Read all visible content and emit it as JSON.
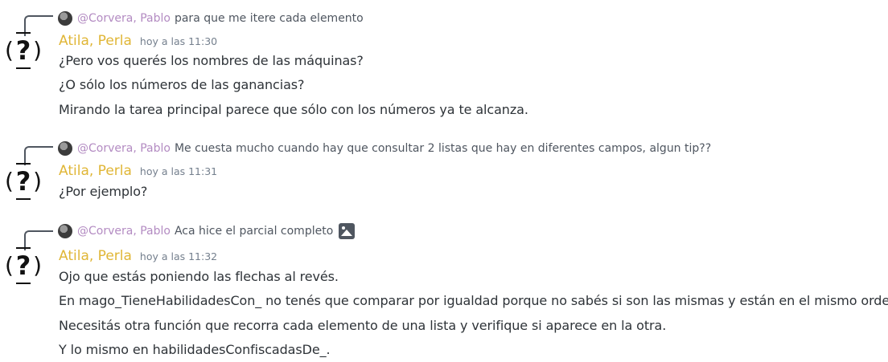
{
  "messages": [
    {
      "reply": {
        "author": "@Corvera, Pablo",
        "text": "para que me itere cada elemento",
        "has_image": false
      },
      "author": "Atila, Perla",
      "time": "hoy a las 11:30",
      "lines": [
        "¿Pero vos querés los nombres de las máquinas?",
        "¿O sólo los números de las ganancias?",
        "Mirando la tarea principal parece que sólo con los números ya te alcanza."
      ]
    },
    {
      "reply": {
        "author": "@Corvera, Pablo",
        "text": "Me cuesta mucho cuando hay que consultar 2 listas que hay en diferentes campos, algun tip??",
        "has_image": false
      },
      "author": "Atila, Perla",
      "time": "hoy a las 11:31",
      "lines": [
        "¿Por ejemplo?"
      ]
    },
    {
      "reply": {
        "author": "@Corvera, Pablo",
        "text": "Aca hice el parcial completo",
        "has_image": true,
        "image_icon": "image-icon"
      },
      "author": "Atila, Perla",
      "time": "hoy a las 11:32",
      "lines": [
        "Ojo que estás poniendo las flechas al revés.",
        "En mago_TieneHabilidadesCon_ no tenés que comparar por igualdad porque no sabés si son las mismas y están en el mismo orden.",
        "Necesitás otra función que recorra cada elemento de una lista y verifique si aparece en la otra.",
        "Y lo mismo en habilidadesConfiscadasDe_."
      ]
    }
  ],
  "avatar_glyph": "?",
  "colors": {
    "author": "#e0b636",
    "reply_author": "#b38bc2",
    "text": "#2e3338",
    "muted": "#747f8d"
  }
}
